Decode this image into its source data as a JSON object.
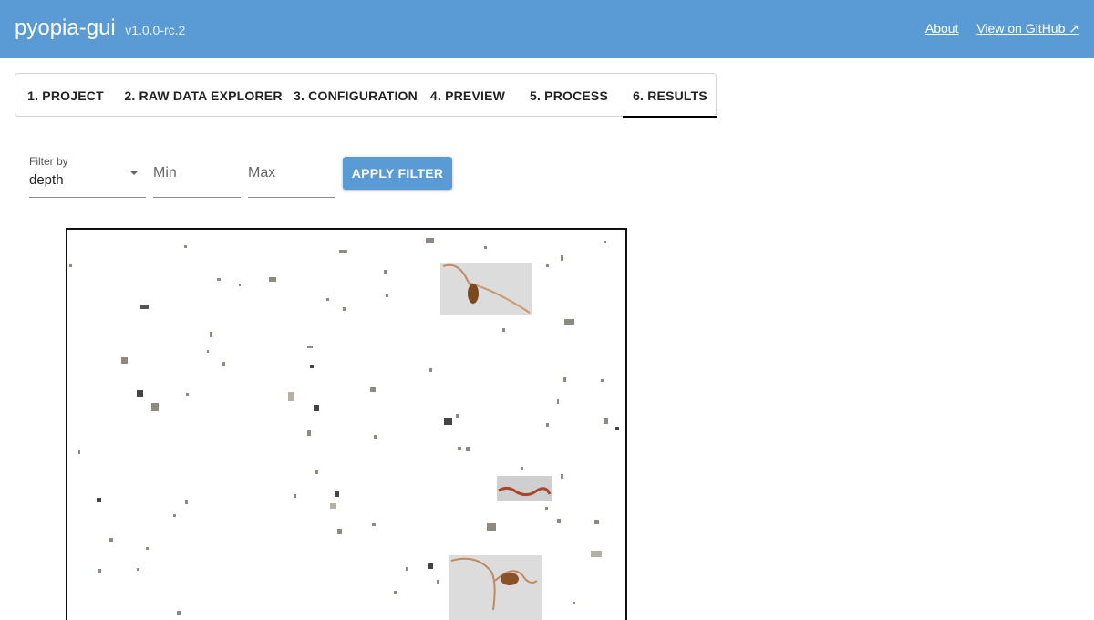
{
  "app": {
    "name": "pyopia-gui",
    "version": "v1.0.0-rc.2",
    "links": [
      {
        "label": "About"
      },
      {
        "label": "View on GitHub ↗"
      }
    ]
  },
  "tabs": [
    {
      "label": "1. PROJECT",
      "active": false
    },
    {
      "label": "2. RAW DATA EXPLORER",
      "active": false
    },
    {
      "label": "3. CONFIGURATION",
      "active": false
    },
    {
      "label": "4. PREVIEW",
      "active": false
    },
    {
      "label": "5. PROCESS",
      "active": false
    },
    {
      "label": "6. RESULTS",
      "active": true
    }
  ],
  "filter": {
    "label": "Filter by",
    "selected": "depth",
    "min_placeholder": "Min",
    "max_placeholder": "Max",
    "apply_label": "APPLY FILTER"
  },
  "colors": {
    "appbar": "#5b9bd5",
    "button": "#5b9bd5",
    "particle": "#8e8a80",
    "organism": "#b36a3c"
  },
  "montage": {
    "description_icon": "particle-montage-image"
  }
}
